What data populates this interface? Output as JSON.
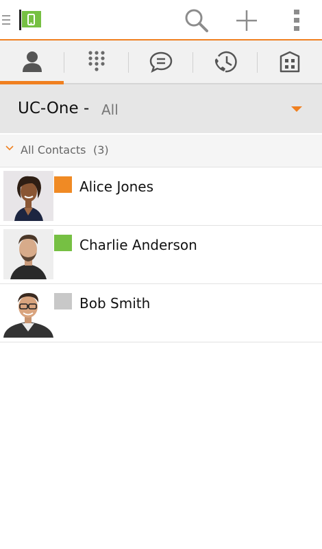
{
  "header": {
    "menu_icon": "hamburger-icon",
    "logo_icon": "flag-phone-logo",
    "actions": [
      {
        "icon": "search-icon"
      },
      {
        "icon": "plus-icon"
      },
      {
        "icon": "overflow-menu-icon"
      }
    ]
  },
  "tabs": [
    {
      "icon": "contacts-icon",
      "selected": true
    },
    {
      "icon": "dialpad-icon",
      "selected": false
    },
    {
      "icon": "chat-icon",
      "selected": false
    },
    {
      "icon": "call-history-icon",
      "selected": false
    },
    {
      "icon": "directory-icon",
      "selected": false
    }
  ],
  "source": {
    "name": "UC-One -",
    "filter": "All"
  },
  "group": {
    "label": "All Contacts",
    "count": "(3)"
  },
  "contacts": [
    {
      "name": "Alice Jones",
      "presence": "away",
      "flag_color": "#f08a24"
    },
    {
      "name": "Charlie Anderson",
      "presence": "available",
      "flag_color": "#76c043"
    },
    {
      "name": "Bob Smith",
      "presence": "offline",
      "flag_color": "#c8c8c8"
    }
  ],
  "colors": {
    "accent": "#f08020",
    "logo_green": "#76c043"
  }
}
